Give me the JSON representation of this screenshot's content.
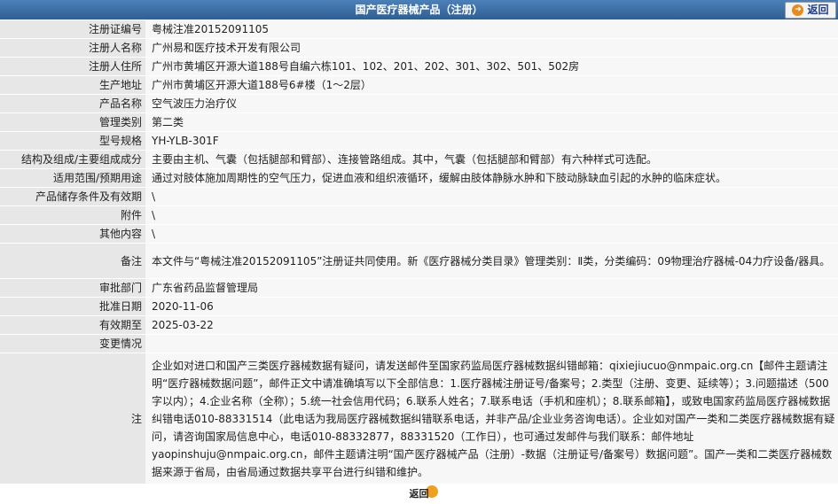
{
  "header": {
    "title": "国产医疗器械产品（注册）",
    "back_label": "返回"
  },
  "fields": [
    {
      "label": "注册证编号",
      "value": "粤械注准20152091105"
    },
    {
      "label": "注册人名称",
      "value": "广州易和医疗技术开发有限公司"
    },
    {
      "label": "注册人住所",
      "value": "广州市黄埔区开源大道188号自编六栋101、102、201、202、301、302、501、502房"
    },
    {
      "label": "生产地址",
      "value": "广州市黄埔区开源大道188号6#楼（1～2层）"
    },
    {
      "label": "产品名称",
      "value": "空气波压力治疗仪"
    },
    {
      "label": "管理类别",
      "value": "第二类"
    },
    {
      "label": "型号规格",
      "value": "YH-YLB-301F"
    },
    {
      "label": "结构及组成/主要组成成分",
      "value": "主要由主机、气囊（包括腿部和臂部）、连接管路组成。其中，气囊（包括腿部和臂部）有六种样式可选配。"
    },
    {
      "label": "适用范围/预期用途",
      "value": "通过对肢体施加周期性的空气压力，促进血液和组织液循环，缓解由肢体静脉水肿和下肢动脉缺血引起的水肿的临床症状。"
    },
    {
      "label": "产品储存条件及有效期",
      "value": "\\"
    },
    {
      "label": "附件",
      "value": "\\"
    },
    {
      "label": "其他内容",
      "value": "\\"
    },
    {
      "label": "备注",
      "value": "本文件与“粤械注准20152091105”注册证共同使用。新《医疗器械分类目录》管理类别：Ⅱ类，分类编码：09物理治疗器械-04力疗设备/器具。"
    },
    {
      "label": "审批部门",
      "value": "广东省药品监督管理局"
    },
    {
      "label": "批准日期",
      "value": "2020-11-06"
    },
    {
      "label": "有效期至",
      "value": "2025-03-22"
    },
    {
      "label": "变更情况",
      "value": ""
    }
  ],
  "note": {
    "label": "注",
    "text": "企业如对进口和国产三类医疗器械数据有疑问，请发送邮件至国家药监局医疗器械数据纠错邮箱：qixiejiucuo@nmpaic.org.cn【邮件主题请注明“医疗器械数据问题”，邮件正文中请准确填写以下全部信息：1.医疗器械注册证号/备案号；2.类型（注册、变更、延续等）；3.问题描述（500字以内）；4.企业名称（全称）；5.统一社会信用代码；6.联系人姓名；7.联系电话（手机和座机）；8.联系邮箱】，或致电国家药监局医疗器械数据纠错电话010-88331514（此电话为我局医疗器械数据纠错联系电话，并非产品/企业业务咨询电话）。企业如对国产一类和二类医疗器械数据有疑问，请咨询国家局信息中心，电话010-88332877，88331520（工作日），也可通过发邮件与我们联系：邮件地址yaopinshuju@nmpaic.org.cn，邮件主题请注明“国产医疗器械产品（注册）-数据（注册证号/备案号）数据问题”。国产一类和二类医疗器械数据来源于省局，由省局通过数据共享平台进行纠错和维护。"
  },
  "footer": {
    "back_label": "返回"
  }
}
